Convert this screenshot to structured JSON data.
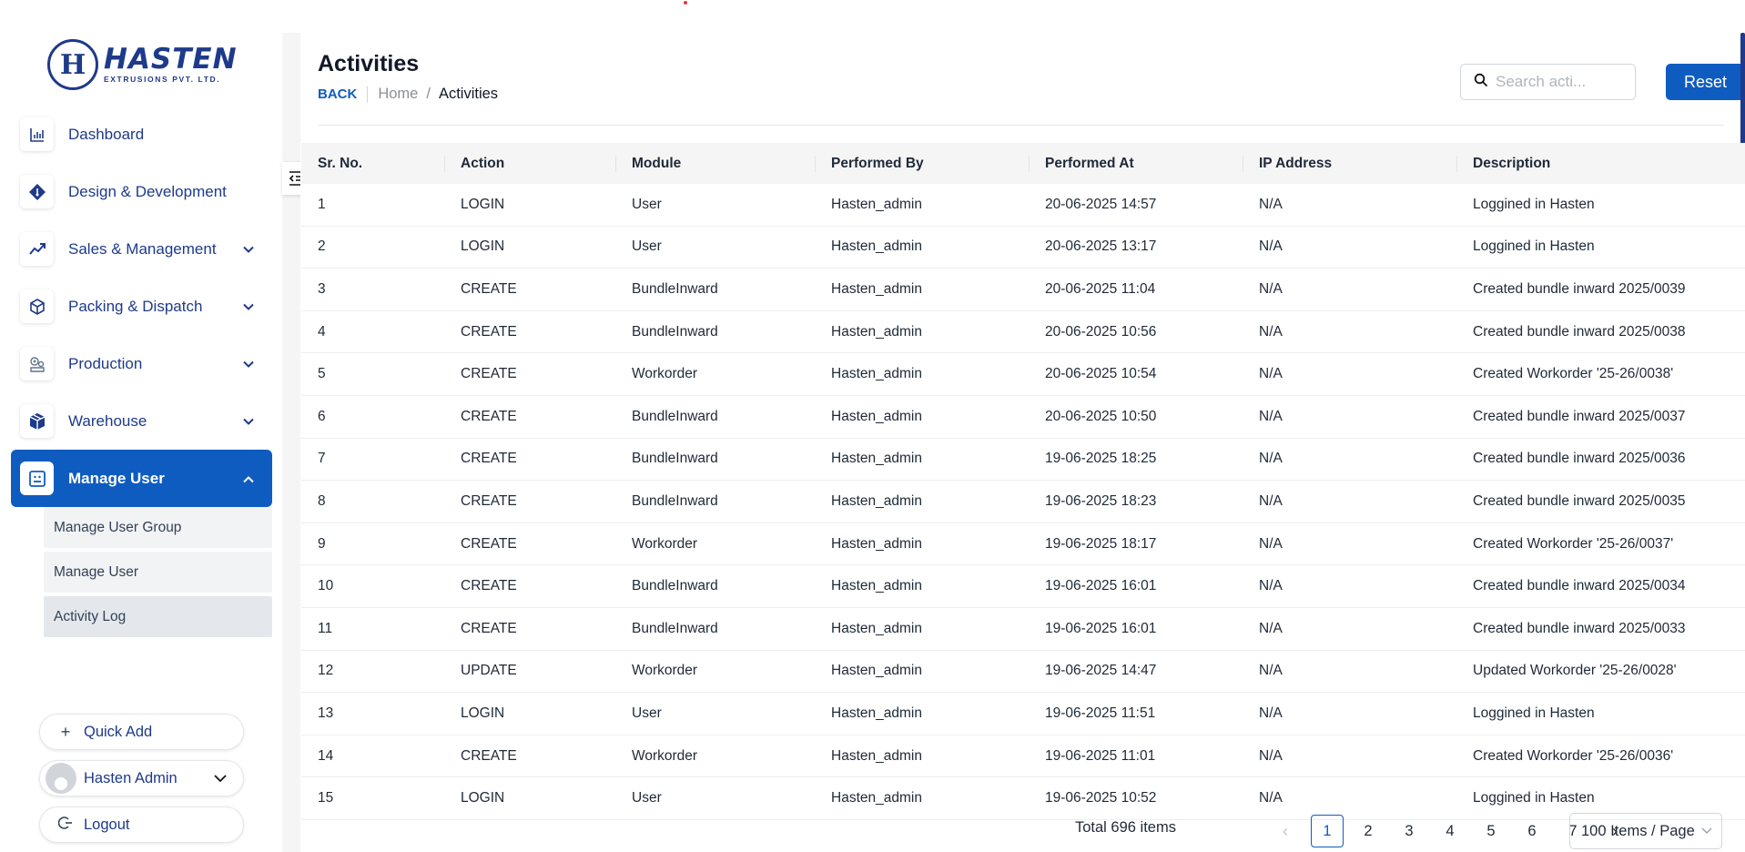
{
  "logo": {
    "mark": "H",
    "name": "HASTEN",
    "tagline": "EXTRUSIONS PVT. LTD."
  },
  "sidebar": {
    "items": [
      {
        "label": "Dashboard",
        "icon": "bar-chart-icon",
        "expandable": false
      },
      {
        "label": "Design & Development",
        "icon": "pen-tool-icon",
        "expandable": false
      },
      {
        "label": "Sales & Management",
        "icon": "trending-up-icon",
        "expandable": true
      },
      {
        "label": "Packing & Dispatch",
        "icon": "box-icon",
        "expandable": true
      },
      {
        "label": "Production",
        "icon": "factory-icon",
        "expandable": true
      },
      {
        "label": "Warehouse",
        "icon": "warehouse-icon",
        "expandable": true
      },
      {
        "label": "Manage User",
        "icon": "user-card-icon",
        "expandable": true,
        "active": true
      }
    ],
    "subitems": [
      {
        "label": "Manage User Group"
      },
      {
        "label": "Manage User"
      },
      {
        "label": "Activity Log",
        "active": true
      }
    ],
    "quick_add": "Quick Add",
    "user_name": "Hasten Admin",
    "logout": "Logout"
  },
  "header": {
    "title": "Activities",
    "back": "BACK",
    "breadcrumb_home": "Home",
    "breadcrumb_sep": "/",
    "breadcrumb_current": "Activities",
    "search_placeholder": "Search acti...",
    "reset": "Reset"
  },
  "table": {
    "columns": [
      "Sr. No.",
      "Action",
      "Module",
      "Performed By",
      "Performed At",
      "IP Address",
      "Description"
    ],
    "rows": [
      [
        "1",
        "LOGIN",
        "User",
        "Hasten_admin",
        "20-06-2025 14:57",
        "N/A",
        "Loggined in Hasten"
      ],
      [
        "2",
        "LOGIN",
        "User",
        "Hasten_admin",
        "20-06-2025 13:17",
        "N/A",
        "Loggined in Hasten"
      ],
      [
        "3",
        "CREATE",
        "BundleInward",
        "Hasten_admin",
        "20-06-2025 11:04",
        "N/A",
        "Created bundle inward 2025/0039"
      ],
      [
        "4",
        "CREATE",
        "BundleInward",
        "Hasten_admin",
        "20-06-2025 10:56",
        "N/A",
        "Created bundle inward 2025/0038"
      ],
      [
        "5",
        "CREATE",
        "Workorder",
        "Hasten_admin",
        "20-06-2025 10:54",
        "N/A",
        "Created Workorder '25-26/0038'"
      ],
      [
        "6",
        "CREATE",
        "BundleInward",
        "Hasten_admin",
        "20-06-2025 10:50",
        "N/A",
        "Created bundle inward 2025/0037"
      ],
      [
        "7",
        "CREATE",
        "BundleInward",
        "Hasten_admin",
        "19-06-2025 18:25",
        "N/A",
        "Created bundle inward 2025/0036"
      ],
      [
        "8",
        "CREATE",
        "BundleInward",
        "Hasten_admin",
        "19-06-2025 18:23",
        "N/A",
        "Created bundle inward 2025/0035"
      ],
      [
        "9",
        "CREATE",
        "Workorder",
        "Hasten_admin",
        "19-06-2025 18:17",
        "N/A",
        "Created Workorder '25-26/0037'"
      ],
      [
        "10",
        "CREATE",
        "BundleInward",
        "Hasten_admin",
        "19-06-2025 16:01",
        "N/A",
        "Created bundle inward 2025/0034"
      ],
      [
        "11",
        "CREATE",
        "BundleInward",
        "Hasten_admin",
        "19-06-2025 16:01",
        "N/A",
        "Created bundle inward 2025/0033"
      ],
      [
        "12",
        "UPDATE",
        "Workorder",
        "Hasten_admin",
        "19-06-2025 14:47",
        "N/A",
        "Updated Workorder '25-26/0028'"
      ],
      [
        "13",
        "LOGIN",
        "User",
        "Hasten_admin",
        "19-06-2025 11:51",
        "N/A",
        "Loggined in Hasten"
      ],
      [
        "14",
        "CREATE",
        "Workorder",
        "Hasten_admin",
        "19-06-2025 11:01",
        "N/A",
        "Created Workorder '25-26/0036'"
      ],
      [
        "15",
        "LOGIN",
        "User",
        "Hasten_admin",
        "19-06-2025 10:52",
        "N/A",
        "Loggined in Hasten"
      ]
    ]
  },
  "pagination": {
    "total": "Total 696 items",
    "pages": [
      "1",
      "2",
      "3",
      "4",
      "5",
      "6",
      "7"
    ],
    "current": "1",
    "prev": "‹",
    "next": "›",
    "page_size": "100 Items / Page"
  },
  "colors": {
    "primary": "#0f5cc0",
    "brand": "#1e3a8a"
  }
}
